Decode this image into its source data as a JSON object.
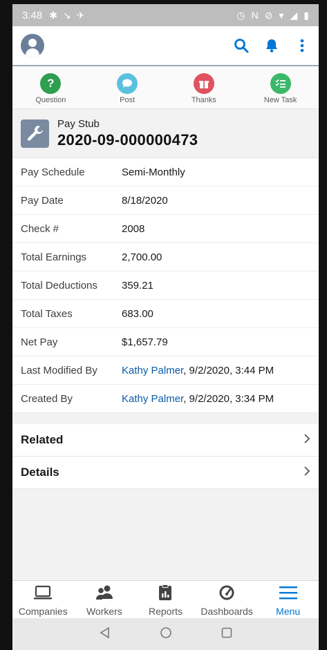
{
  "status_bar": {
    "time": "3:48"
  },
  "quick_actions": [
    {
      "label": "Question",
      "color": "#2e9e4f",
      "icon": "question-icon"
    },
    {
      "label": "Post",
      "color": "#5bc0de",
      "icon": "post-icon"
    },
    {
      "label": "Thanks",
      "color": "#e05260",
      "icon": "gift-icon"
    },
    {
      "label": "New Task",
      "color": "#3bb86a",
      "icon": "task-icon"
    }
  ],
  "record": {
    "type": "Pay Stub",
    "name": "2020-09-000000473"
  },
  "fields": [
    {
      "label": "Pay Schedule",
      "value": "Semi-Monthly"
    },
    {
      "label": "Pay Date",
      "value": "8/18/2020"
    },
    {
      "label": "Check #",
      "value": "2008"
    },
    {
      "label": "Total Earnings",
      "value": "2,700.00"
    },
    {
      "label": "Total Deductions",
      "value": "359.21"
    },
    {
      "label": "Total Taxes",
      "value": "683.00"
    },
    {
      "label": "Net Pay",
      "value": "$1,657.79"
    },
    {
      "label": "Last Modified By",
      "user": "Kathy Palmer",
      "value": ", 9/2/2020, 3:44 PM"
    },
    {
      "label": "Created By",
      "user": "Kathy Palmer",
      "value": ", 9/2/2020, 3:34 PM"
    }
  ],
  "sections": {
    "related": "Related",
    "details": "Details"
  },
  "bottom_nav": [
    {
      "label": "Companies"
    },
    {
      "label": "Workers"
    },
    {
      "label": "Reports"
    },
    {
      "label": "Dashboards"
    },
    {
      "label": "Menu",
      "active": true
    }
  ],
  "colors": {
    "accent": "#0176d3",
    "link": "#0b5cab"
  }
}
